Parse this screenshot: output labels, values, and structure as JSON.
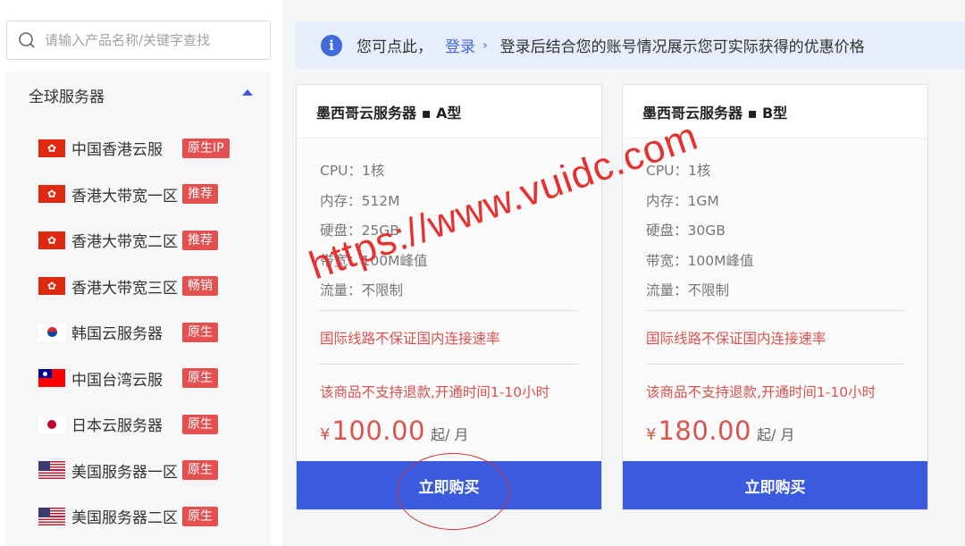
{
  "search": {
    "placeholder": "请输入产品名称/关键字查找"
  },
  "sidebar": {
    "category_title": "全球服务器",
    "items": [
      {
        "label": "中国香港云服",
        "badge": "原生IP",
        "flag": "hk"
      },
      {
        "label": "香港大带宽一区",
        "badge": "推荐",
        "flag": "hk"
      },
      {
        "label": "香港大带宽二区",
        "badge": "推荐",
        "flag": "hk"
      },
      {
        "label": "香港大带宽三区",
        "badge": "畅销",
        "flag": "hk"
      },
      {
        "label": "韩国云服务器",
        "badge": "原生",
        "flag": "kr"
      },
      {
        "label": "中国台湾云服",
        "badge": "原生",
        "flag": "tw"
      },
      {
        "label": "日本云服务器",
        "badge": "原生",
        "flag": "jp"
      },
      {
        "label": "美国服务器一区",
        "badge": "原生",
        "flag": "us"
      },
      {
        "label": "美国服务器二区",
        "badge": "原生",
        "flag": "us"
      }
    ]
  },
  "notice": {
    "prefix": "您可点此，",
    "login": "登录",
    "chevron": "›",
    "text": "登录后结合您的账号情况展示您可实际获得的优惠价格"
  },
  "cards": [
    {
      "title": "墨西哥云服务器 ▪ A型",
      "cpu": "CPU：1核",
      "memory": "内存：512M",
      "disk": "硬盘：25GB",
      "bandwidth": "带宽：100M峰值",
      "traffic": "流量：不限制",
      "warning": "国际线路不保证国内连接速率",
      "refund": "该商品不支持退款,开通时间1-10小时",
      "currency": "¥",
      "price": "100.00",
      "unit": "起/ 月",
      "button": "立即购买"
    },
    {
      "title": "墨西哥云服务器 ▪ B型",
      "cpu": "CPU：1核",
      "memory": "内存：1GM",
      "disk": "硬盘：30GB",
      "bandwidth": "带宽：100M峰值",
      "traffic": "流量：不限制",
      "warning": "国际线路不保证国内连接速率",
      "refund": "该商品不支持退款,开通时间1-10小时",
      "currency": "¥",
      "price": "180.00",
      "unit": "起/ 月",
      "button": "立即购买"
    }
  ],
  "watermark": "https://www.vuidc.com",
  "colors": {
    "accent": "#3a5be0",
    "badge": "#e45050",
    "warning": "#d9534f",
    "notice_bg": "#e7edfa"
  }
}
